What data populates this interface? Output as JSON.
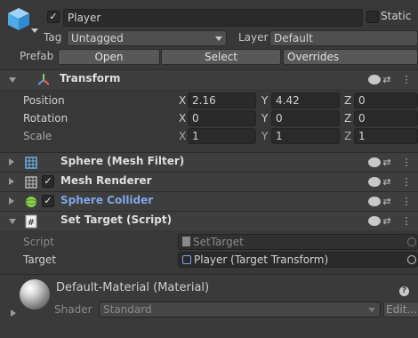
{
  "gameobject": {
    "name": "Player",
    "static_label": "Static",
    "tag_label": "Tag",
    "tag_value": "Untagged",
    "layer_label": "Layer",
    "layer_value": "Default",
    "prefab_label": "Prefab",
    "prefab_open": "Open",
    "prefab_select": "Select",
    "prefab_overrides": "Overrides",
    "active": true
  },
  "transform": {
    "title": "Transform",
    "rows": [
      {
        "label": "Position",
        "x": "2.16",
        "y": "4.42",
        "z": "0"
      },
      {
        "label": "Rotation",
        "x": "0",
        "y": "0",
        "z": "0"
      },
      {
        "label": "Scale",
        "x": "1",
        "y": "1",
        "z": "1"
      }
    ],
    "axis_x": "X",
    "axis_y": "Y",
    "axis_z": "Z"
  },
  "components": [
    {
      "title": "Sphere (Mesh Filter)",
      "icon": "mesh-filter-icon",
      "has_checkbox": false
    },
    {
      "title": "Mesh Renderer",
      "icon": "mesh-renderer-icon",
      "has_checkbox": true
    },
    {
      "title": "Sphere Collider",
      "icon": "sphere-collider-icon",
      "has_checkbox": true,
      "highlight": "#7fa7e8"
    }
  ],
  "script": {
    "title": "Set Target (Script)",
    "script_label": "Script",
    "script_value": "SetTarget",
    "target_label": "Target",
    "target_value": "Player (Target Transform)"
  },
  "material": {
    "name": "Default-Material (Material)",
    "shader_label": "Shader",
    "shader_value": "Standard",
    "edit_label": "Edit..."
  },
  "icons": {
    "help": "?",
    "presets": "⇄",
    "menu": "⋮",
    "check": "✓"
  }
}
